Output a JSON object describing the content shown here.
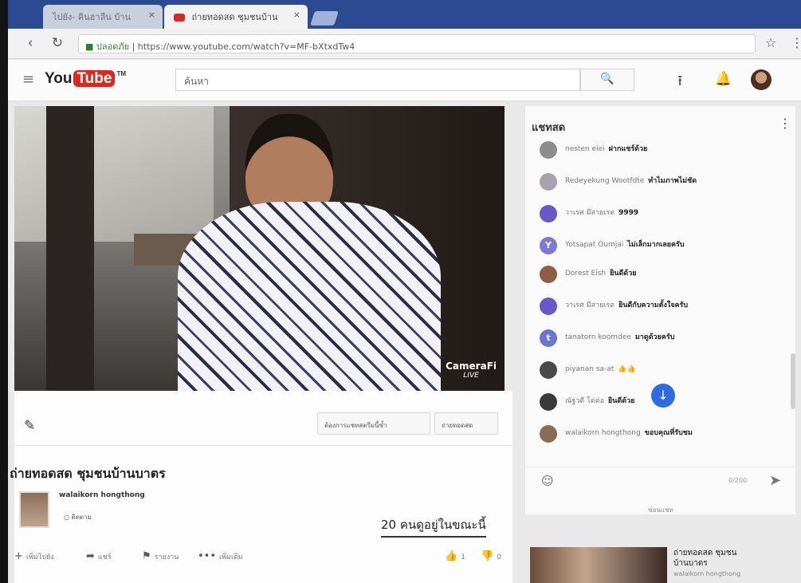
{
  "browser": {
    "tabs": [
      {
        "label": "ไปยัง- คินฮาลีน บ้าน",
        "active": false
      },
      {
        "label": "ถ่ายทอดสด ชุมชนบ้าน",
        "active": true
      }
    ],
    "tab_close": "×",
    "address": {
      "secure_label": "ปลอดภัย",
      "url": "https://www.youtube.com/watch?v=MF-bXtxdTw4"
    }
  },
  "youtube": {
    "logo_you": "You",
    "logo_tube": "Tube",
    "logo_tm": "TM",
    "search": {
      "placeholder": "ค้นหา",
      "value": "ค้นหา"
    }
  },
  "video": {
    "overlay_brand": "CameraFi",
    "overlay_live": "LIVE",
    "pill_buttons": [
      "ต้องการแชทสตรีมนี้ซ้ำ",
      "ถ่ายทอดสด"
    ],
    "title": "ถ่ายทอดสด ชุมชนบ้านบาตร",
    "owner": "walaikorn hongthong",
    "subscribe": "ติดตาม",
    "viewers": "20 คนดูอยู่ในขณะนี้",
    "actions": [
      "เพิ่มไปยัง",
      "แชร์",
      "รายงาน",
      "เพิ่มเติม"
    ],
    "likes": "1",
    "dislikes": "0"
  },
  "chat": {
    "title": "แชทสด",
    "messages": [
      {
        "author": "nesten eiei",
        "text": "ฝากแชร์ด้วย",
        "avatar_color": "#8d8d8d",
        "letter": ""
      },
      {
        "author": "Redeyekung Wootfdte",
        "text": "ทำไมภาพไม่ชัด",
        "avatar_color": "#a7a2b0",
        "letter": ""
      },
      {
        "author": "วาเรศ มีสายเรด",
        "text": "9999",
        "avatar_color": "#6a58c9",
        "letter": ""
      },
      {
        "author": "Yotsapat Oumjai",
        "text": "ไม่เล็กมากเลยครับ",
        "avatar_color": "#7d79d9",
        "letter": "Y"
      },
      {
        "author": "Dorest Eish",
        "text": "ยินดีด้วย",
        "avatar_color": "#8f5e46",
        "letter": ""
      },
      {
        "author": "วาเรศ มีสายเรด",
        "text": "ยินดีกับความตั้งใจครับ",
        "avatar_color": "#6a58c9",
        "letter": ""
      },
      {
        "author": "tanatorn koomdee",
        "text": "มาดูด้วยครับ",
        "avatar_color": "#6a75d0",
        "letter": "t"
      },
      {
        "author": "piyanan sa-at",
        "text": "👍👍",
        "avatar_color": "#4a4a4a",
        "letter": ""
      },
      {
        "author": "ณัฐวดี โด่ต่อ",
        "text": "ยินดีด้วย",
        "avatar_color": "#3a3a3a",
        "letter": ""
      },
      {
        "author": "walaikorn hongthong",
        "text": "ขอบคุณที่รับชม",
        "avatar_color": "#8a6b53",
        "letter": ""
      }
    ],
    "char_count": "0/200",
    "hide_label": "ซ่อนแชท"
  },
  "related": {
    "title": "ถ่ายทอดสด ชุมชนบ้านบาตร",
    "channel": "walaikorn hongthong"
  }
}
